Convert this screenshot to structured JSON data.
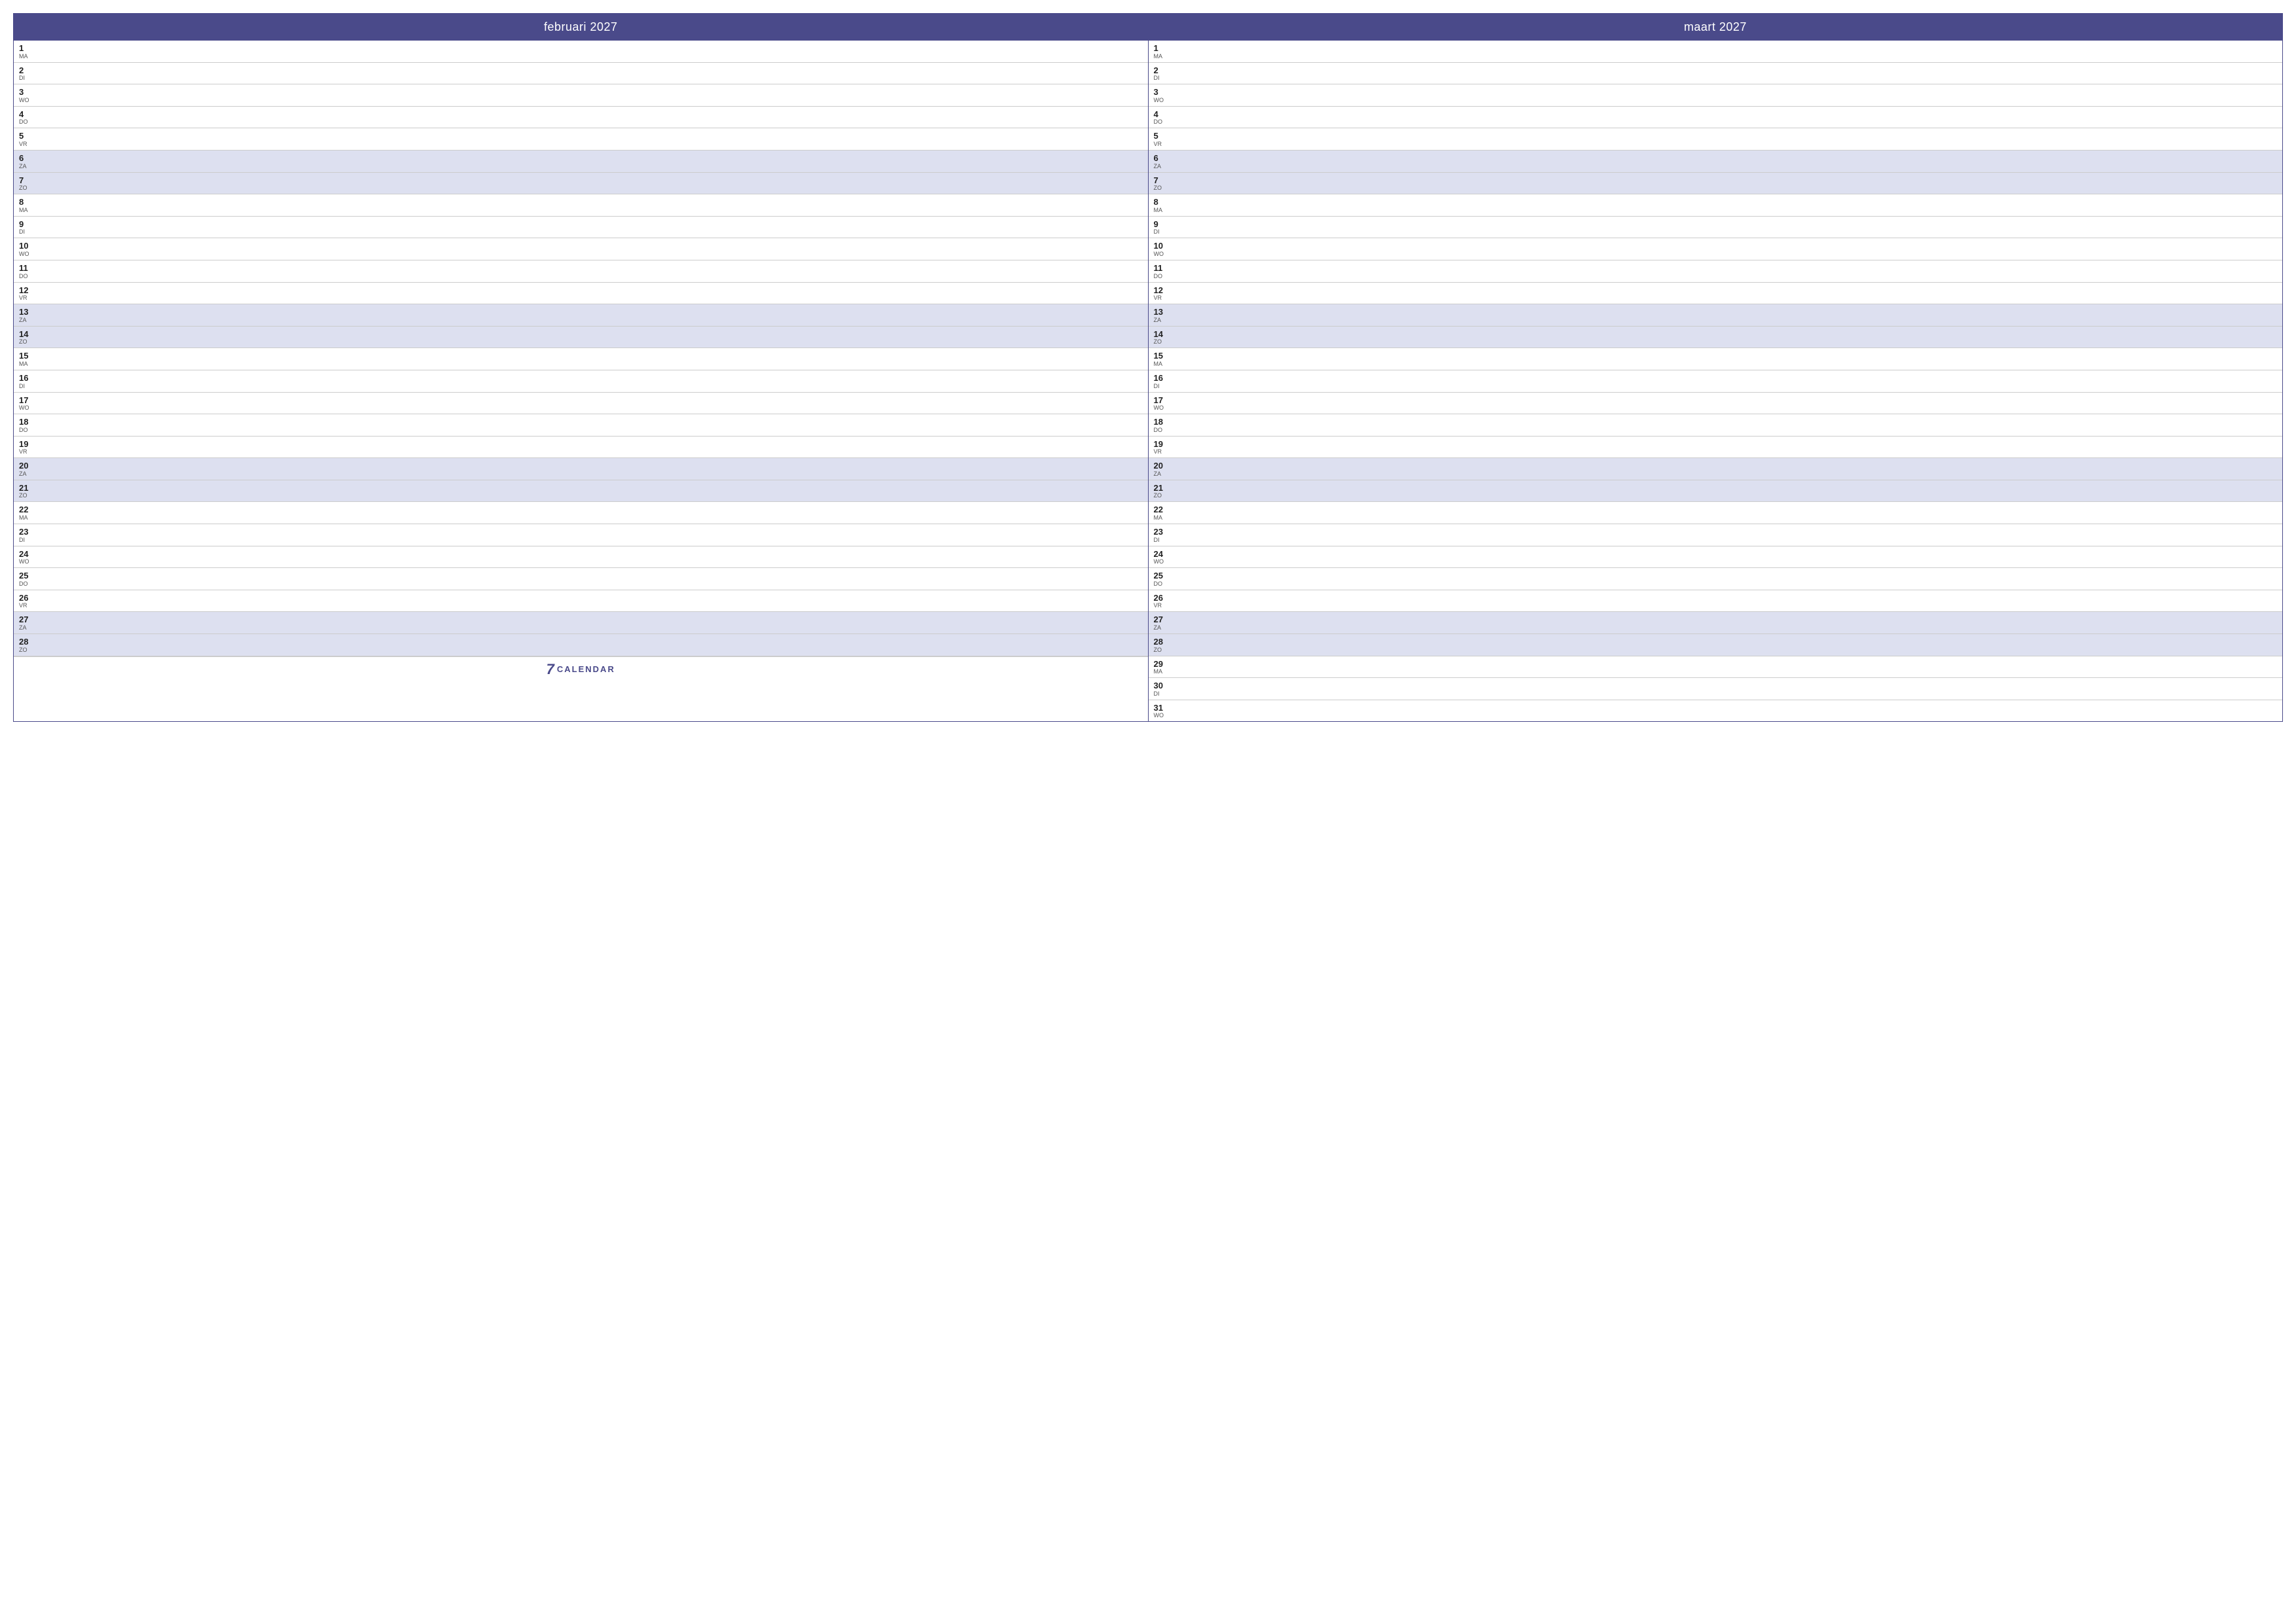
{
  "calendar": {
    "months": [
      {
        "id": "februari-2027",
        "label": "februari 2027",
        "days": [
          {
            "number": "1",
            "abbr": "MA",
            "weekend": false
          },
          {
            "number": "2",
            "abbr": "DI",
            "weekend": false
          },
          {
            "number": "3",
            "abbr": "WO",
            "weekend": false
          },
          {
            "number": "4",
            "abbr": "DO",
            "weekend": false
          },
          {
            "number": "5",
            "abbr": "VR",
            "weekend": false
          },
          {
            "number": "6",
            "abbr": "ZA",
            "weekend": true
          },
          {
            "number": "7",
            "abbr": "ZO",
            "weekend": true
          },
          {
            "number": "8",
            "abbr": "MA",
            "weekend": false
          },
          {
            "number": "9",
            "abbr": "DI",
            "weekend": false
          },
          {
            "number": "10",
            "abbr": "WO",
            "weekend": false
          },
          {
            "number": "11",
            "abbr": "DO",
            "weekend": false
          },
          {
            "number": "12",
            "abbr": "VR",
            "weekend": false
          },
          {
            "number": "13",
            "abbr": "ZA",
            "weekend": true
          },
          {
            "number": "14",
            "abbr": "ZO",
            "weekend": true
          },
          {
            "number": "15",
            "abbr": "MA",
            "weekend": false
          },
          {
            "number": "16",
            "abbr": "DI",
            "weekend": false
          },
          {
            "number": "17",
            "abbr": "WO",
            "weekend": false
          },
          {
            "number": "18",
            "abbr": "DO",
            "weekend": false
          },
          {
            "number": "19",
            "abbr": "VR",
            "weekend": false
          },
          {
            "number": "20",
            "abbr": "ZA",
            "weekend": true
          },
          {
            "number": "21",
            "abbr": "ZO",
            "weekend": true
          },
          {
            "number": "22",
            "abbr": "MA",
            "weekend": false
          },
          {
            "number": "23",
            "abbr": "DI",
            "weekend": false
          },
          {
            "number": "24",
            "abbr": "WO",
            "weekend": false
          },
          {
            "number": "25",
            "abbr": "DO",
            "weekend": false
          },
          {
            "number": "26",
            "abbr": "VR",
            "weekend": false
          },
          {
            "number": "27",
            "abbr": "ZA",
            "weekend": true
          },
          {
            "number": "28",
            "abbr": "ZO",
            "weekend": true
          }
        ]
      },
      {
        "id": "maart-2027",
        "label": "maart 2027",
        "days": [
          {
            "number": "1",
            "abbr": "MA",
            "weekend": false
          },
          {
            "number": "2",
            "abbr": "DI",
            "weekend": false
          },
          {
            "number": "3",
            "abbr": "WO",
            "weekend": false
          },
          {
            "number": "4",
            "abbr": "DO",
            "weekend": false
          },
          {
            "number": "5",
            "abbr": "VR",
            "weekend": false
          },
          {
            "number": "6",
            "abbr": "ZA",
            "weekend": true
          },
          {
            "number": "7",
            "abbr": "ZO",
            "weekend": true
          },
          {
            "number": "8",
            "abbr": "MA",
            "weekend": false
          },
          {
            "number": "9",
            "abbr": "DI",
            "weekend": false
          },
          {
            "number": "10",
            "abbr": "WO",
            "weekend": false
          },
          {
            "number": "11",
            "abbr": "DO",
            "weekend": false
          },
          {
            "number": "12",
            "abbr": "VR",
            "weekend": false
          },
          {
            "number": "13",
            "abbr": "ZA",
            "weekend": true
          },
          {
            "number": "14",
            "abbr": "ZO",
            "weekend": true
          },
          {
            "number": "15",
            "abbr": "MA",
            "weekend": false
          },
          {
            "number": "16",
            "abbr": "DI",
            "weekend": false
          },
          {
            "number": "17",
            "abbr": "WO",
            "weekend": false
          },
          {
            "number": "18",
            "abbr": "DO",
            "weekend": false
          },
          {
            "number": "19",
            "abbr": "VR",
            "weekend": false
          },
          {
            "number": "20",
            "abbr": "ZA",
            "weekend": true
          },
          {
            "number": "21",
            "abbr": "ZO",
            "weekend": true
          },
          {
            "number": "22",
            "abbr": "MA",
            "weekend": false
          },
          {
            "number": "23",
            "abbr": "DI",
            "weekend": false
          },
          {
            "number": "24",
            "abbr": "WO",
            "weekend": false
          },
          {
            "number": "25",
            "abbr": "DO",
            "weekend": false
          },
          {
            "number": "26",
            "abbr": "VR",
            "weekend": false
          },
          {
            "number": "27",
            "abbr": "ZA",
            "weekend": true
          },
          {
            "number": "28",
            "abbr": "ZO",
            "weekend": true
          },
          {
            "number": "29",
            "abbr": "MA",
            "weekend": false
          },
          {
            "number": "30",
            "abbr": "DI",
            "weekend": false
          },
          {
            "number": "31",
            "abbr": "WO",
            "weekend": false
          }
        ]
      }
    ],
    "footer": {
      "logo_number": "7",
      "logo_text": "CALENDAR"
    }
  }
}
